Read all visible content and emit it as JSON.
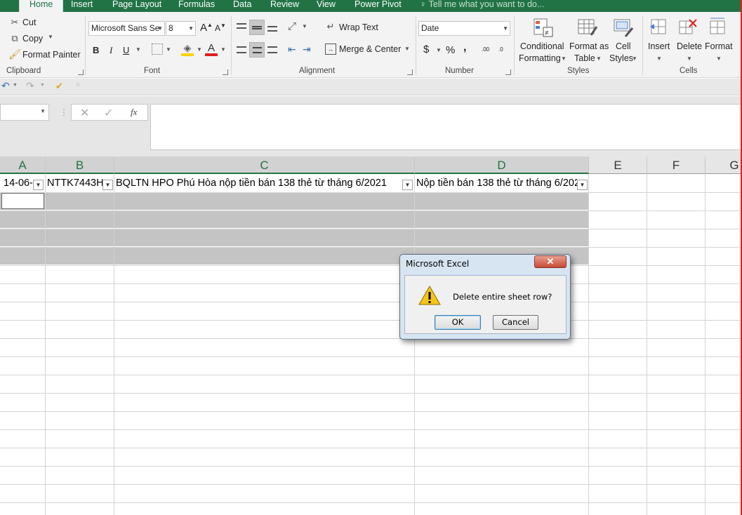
{
  "ribbon_tabs": [
    "Home",
    "Insert",
    "Page Layout",
    "Formulas",
    "Data",
    "Review",
    "View",
    "Power Pivot"
  ],
  "tell_me": "Tell me what you want to do...",
  "clipboard": {
    "cut": "Cut",
    "copy": "Copy",
    "format_painter": "Format Painter",
    "label": "Clipboard"
  },
  "font": {
    "name": "Microsoft Sans Se",
    "size": "8",
    "bold": "B",
    "italic": "I",
    "underline": "U",
    "label": "Font"
  },
  "alignment": {
    "wrap_text": "Wrap Text",
    "merge_center": "Merge & Center",
    "label": "Alignment"
  },
  "number": {
    "format": "Date",
    "currency": "$",
    "percent": "%",
    "comma": ",",
    "inc_decimal": ".00",
    "dec_decimal": ".0",
    "label": "Number"
  },
  "styles": {
    "conditional_line1": "Conditional",
    "conditional_line2": "Formatting",
    "format_as_line1": "Format as",
    "format_as_line2": "Table",
    "cell_styles_line1": "Cell",
    "cell_styles_line2": "Styles",
    "label": "Styles"
  },
  "cells": {
    "insert": "Insert",
    "delete": "Delete",
    "format": "Format",
    "label": "Cells"
  },
  "formula_bar": {
    "fx": "fx",
    "name_box": "",
    "formula": ""
  },
  "columns": [
    "A",
    "B",
    "C",
    "D",
    "E",
    "F",
    "G"
  ],
  "header_row": {
    "a": "14-06-",
    "b": "NTTK7443H",
    "c": "BQLTN HPO Phú Hòa nộp tiền bán 138 thẻ từ tháng 6/2021",
    "d": "Nộp tiền bán 138 thẻ từ tháng 6/202"
  },
  "dialog": {
    "title": "Microsoft Excel",
    "close": "✕",
    "message": "Delete entire sheet row?",
    "ok": "OK",
    "cancel": "Cancel"
  },
  "colors": {
    "accent": "#217346",
    "selection": "#c4c4c4",
    "dialog_frame": "#d7e4f2"
  }
}
